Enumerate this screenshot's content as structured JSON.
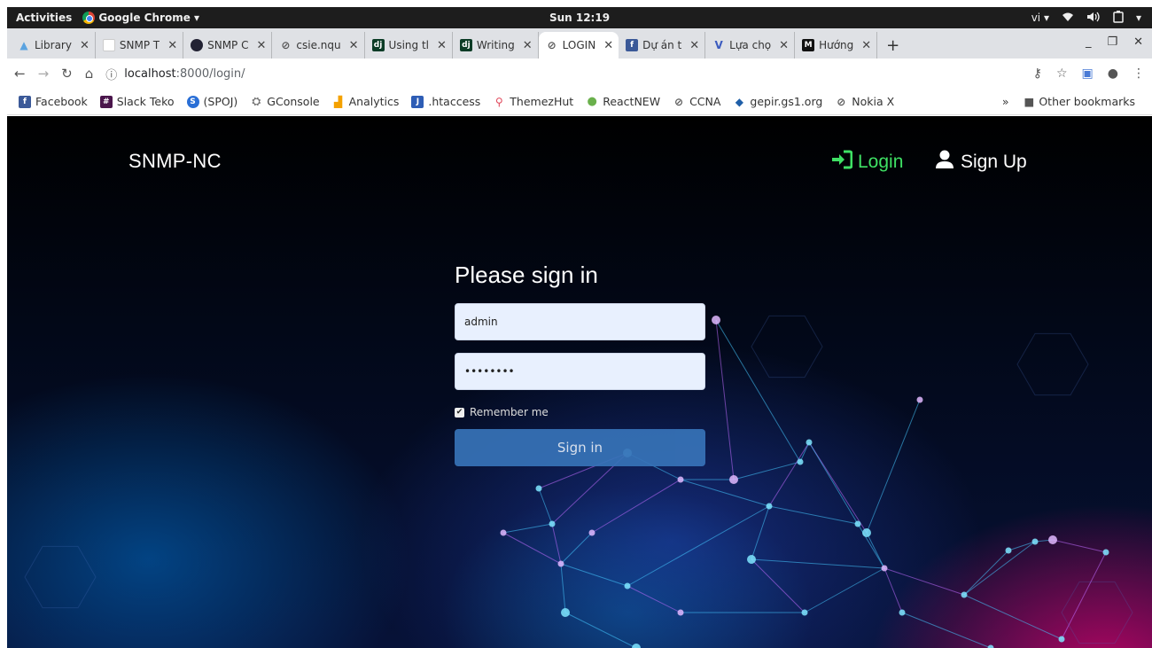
{
  "system": {
    "activities": "Activities",
    "app_name": "Google Chrome ▾",
    "clock": "Sun 12:19",
    "input_method": "vi ▾"
  },
  "tabs": [
    {
      "title": "Library",
      "active": false
    },
    {
      "title": "SNMP T",
      "active": false
    },
    {
      "title": "SNMP C",
      "active": false
    },
    {
      "title": "csie.nqu",
      "active": false
    },
    {
      "title": "Using tl",
      "active": false
    },
    {
      "title": "Writing",
      "active": false
    },
    {
      "title": "LOGIN",
      "active": true
    },
    {
      "title": "Dự án t",
      "active": false
    },
    {
      "title": "Lựa chọ",
      "active": false
    },
    {
      "title": "Hướng",
      "active": false
    }
  ],
  "toolbar": {
    "url_host": "localhost",
    "url_path": ":8000/login/"
  },
  "bookmarks": [
    "Facebook",
    "Slack Teko",
    "(SPOJ)",
    "GConsole",
    "Analytics",
    ".htaccess",
    "ThemezHut",
    "ReactNEW",
    "CCNA",
    "gepir.gs1.org",
    "Nokia X"
  ],
  "bookmarks_more": "»",
  "other_bookmarks": "Other bookmarks",
  "page": {
    "brand": "SNMP-NC",
    "nav_login": "Login",
    "nav_signup": "Sign Up",
    "form_title": "Please sign in",
    "username_value": "admin",
    "password_value": "password",
    "remember_label": "Remember me",
    "remember_checked": true,
    "submit_label": "Sign in"
  },
  "colors": {
    "login_link": "#3ee064",
    "button": "#3773b8",
    "input_bg": "#e8f0fe"
  }
}
